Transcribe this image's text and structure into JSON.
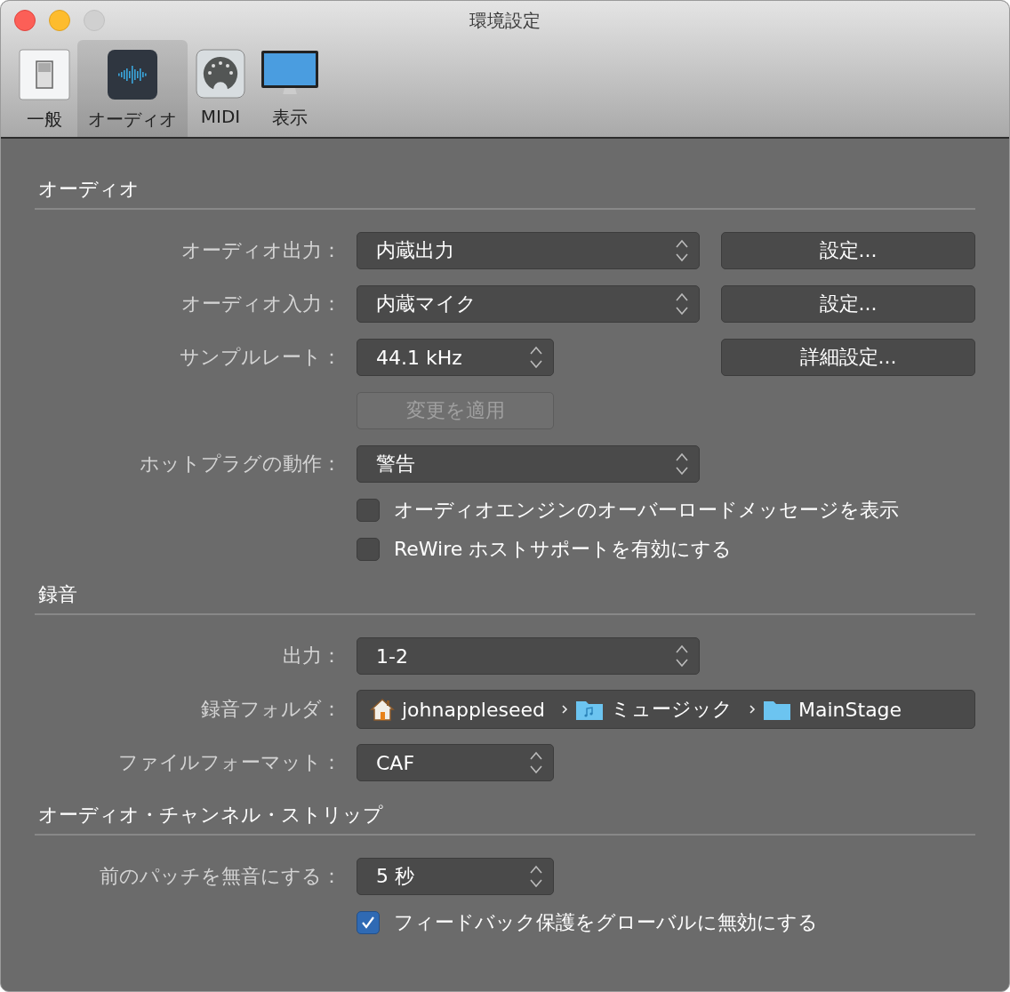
{
  "window": {
    "title": "環境設定"
  },
  "tabs": [
    {
      "label": "一般",
      "selected": false
    },
    {
      "label": "オーディオ",
      "selected": true
    },
    {
      "label": "MIDI",
      "selected": false
    },
    {
      "label": "表示",
      "selected": false
    }
  ],
  "sections": [
    {
      "title": "オーディオ",
      "rows": [
        {
          "kind": "popup",
          "label": "オーディオ出力：",
          "value": "内蔵出力",
          "button": "設定..."
        },
        {
          "kind": "popup",
          "label": "オーディオ入力：",
          "value": "内蔵マイク",
          "button": "設定..."
        },
        {
          "kind": "short-popup",
          "label": "サンプルレート：",
          "value": "44.1 kHz",
          "button": "詳細設定..."
        },
        {
          "kind": "button",
          "label": "変更を適用",
          "disabled": true
        },
        {
          "kind": "popup",
          "label": "ホットプラグの動作：",
          "value": "警告"
        },
        {
          "kind": "checkbox",
          "label": "オーディオエンジンのオーバーロードメッセージを表示",
          "checked": false
        },
        {
          "kind": "checkbox",
          "label": "ReWire ホストサポートを有効にする",
          "checked": false
        }
      ]
    },
    {
      "title": "録音",
      "rows": [
        {
          "kind": "popup",
          "label": "出力：",
          "value": "1-2"
        },
        {
          "kind": "path",
          "label": "録音フォルダ：",
          "segments": [
            "johnappleseed",
            "ミュージック",
            "MainStage"
          ]
        },
        {
          "kind": "short-popup",
          "label": "ファイルフォーマット：",
          "value": "CAF"
        }
      ]
    },
    {
      "title": "オーディオ・チャンネル・ストリップ",
      "rows": [
        {
          "kind": "short-popup",
          "label": "前のパッチを無音にする：",
          "value": "5 秒"
        },
        {
          "kind": "checkbox",
          "label": "フィードバック保護をグローバルに無効にする",
          "checked": true
        }
      ]
    }
  ]
}
